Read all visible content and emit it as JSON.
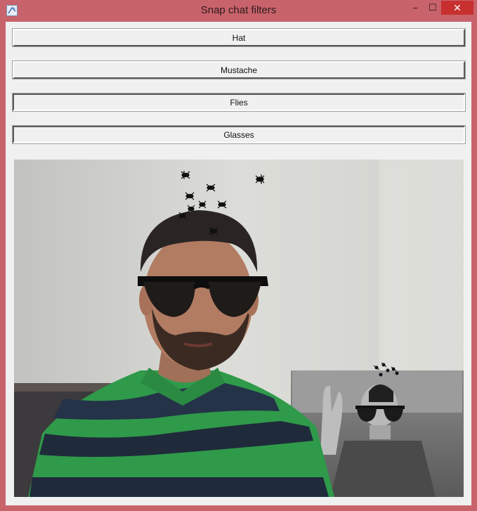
{
  "window": {
    "title": "Snap chat filters",
    "controls": {
      "minimize": "−",
      "maximize": "☐",
      "close": "✕"
    }
  },
  "buttons": [
    {
      "label": "Hat",
      "pressed": false
    },
    {
      "label": "Mustache",
      "pressed": false
    },
    {
      "label": "Flies",
      "pressed": true
    },
    {
      "label": "Glasses",
      "pressed": true
    }
  ],
  "video": {
    "active_filters": [
      "Flies",
      "Glasses"
    ],
    "accent": {
      "shirt_green": "#2f9a4a",
      "shirt_navy": "#1f2b3a",
      "wall": "#d6d7d2"
    }
  }
}
